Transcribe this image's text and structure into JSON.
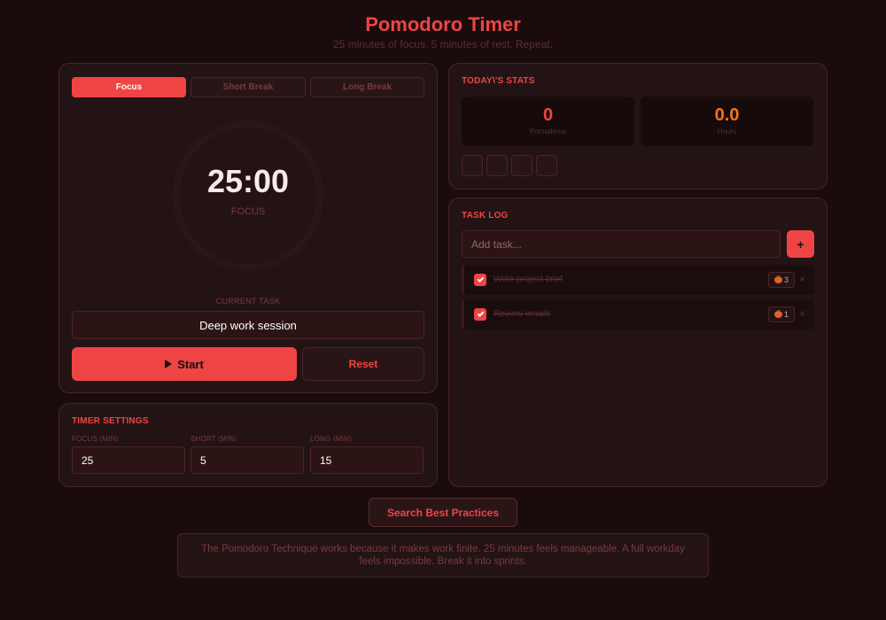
{
  "header": {
    "title": "Pomodoro Timer",
    "subtitle": "25 minutes of focus. 5 minutes of rest. Repeat."
  },
  "timer": {
    "tabs": [
      {
        "label": "Focus",
        "active": true
      },
      {
        "label": "Short Break",
        "active": false
      },
      {
        "label": "Long Break",
        "active": false
      }
    ],
    "time": "25:00",
    "mode_label": "FOCUS",
    "current_task_label": "CURRENT TASK",
    "current_task_value": "Deep work session",
    "start_label": "Start",
    "reset_label": "Reset"
  },
  "settings": {
    "title": "TIMER SETTINGS",
    "fields": [
      {
        "label": "FOCUS (MIN)",
        "value": "25"
      },
      {
        "label": "SHORT (MIN)",
        "value": "5"
      },
      {
        "label": "LONG (MIN)",
        "value": "15"
      }
    ]
  },
  "stats": {
    "title": "TODAY\\'S STATS",
    "pomodoros_value": "0",
    "pomodoros_label": "Pomodoros",
    "hours_value": "0.0",
    "hours_label": "Hours"
  },
  "tasks": {
    "title": "TASK LOG",
    "add_placeholder": "Add task...",
    "add_button": "+",
    "items": [
      {
        "text": "Write project brief",
        "pomodoros": "3",
        "done": true
      },
      {
        "text": "Review emails",
        "pomodoros": "1",
        "done": true
      }
    ],
    "delete_glyph": "×"
  },
  "footer": {
    "search_button": "Search Best Practices",
    "quote": "The Pomodoro Technique works because it makes work finite. 25 minutes feels manageable. A full workday feels impossible. Break it into sprints."
  },
  "colors": {
    "accent": "#ef4444",
    "hours": "#f97316",
    "background": "#1a0b0c",
    "panel": "#231314"
  },
  "icons": {
    "play": "play-icon",
    "check": "check-icon",
    "tomato": "tomato-icon",
    "delete": "close-icon",
    "add": "plus-icon"
  }
}
